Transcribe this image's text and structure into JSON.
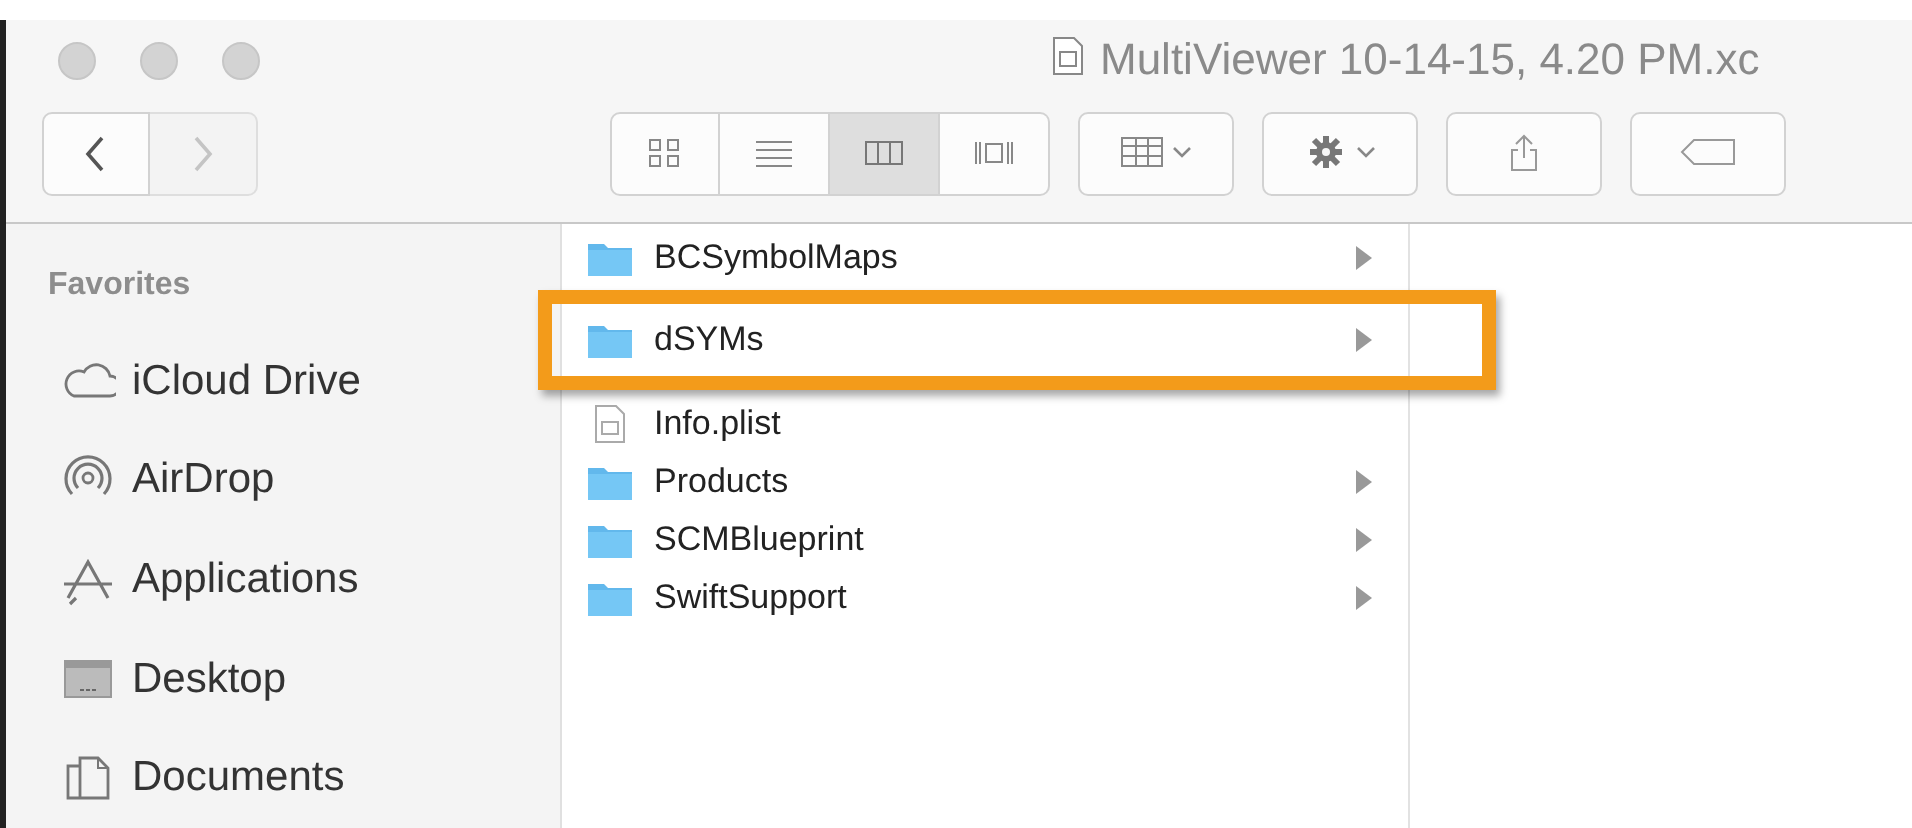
{
  "window": {
    "title": "MultiViewer 10-14-15, 4.20 PM.xc"
  },
  "toolbar": {
    "nav": [
      {
        "kind": "back",
        "disabled": false
      },
      {
        "kind": "forward",
        "disabled": true
      }
    ],
    "view_modes": [
      {
        "kind": "icons",
        "selected": false
      },
      {
        "kind": "list",
        "selected": false
      },
      {
        "kind": "columns",
        "selected": true
      },
      {
        "kind": "coverflow",
        "selected": false
      }
    ],
    "actions": [
      {
        "kind": "arrange"
      },
      {
        "kind": "action"
      },
      {
        "kind": "share"
      },
      {
        "kind": "tag"
      }
    ]
  },
  "sidebar": {
    "heading": "Favorites",
    "items": [
      {
        "label": "iCloud Drive",
        "kind": "cloud"
      },
      {
        "label": "AirDrop",
        "kind": "airdrop"
      },
      {
        "label": "Applications",
        "kind": "apps"
      },
      {
        "label": "Desktop",
        "kind": "desktop"
      },
      {
        "label": "Documents",
        "kind": "documents"
      }
    ]
  },
  "column": {
    "items": [
      {
        "name": "BCSymbolMaps",
        "kind": "folder",
        "has_children": true,
        "highlighted": false
      },
      {
        "name": "dSYMs",
        "kind": "folder",
        "has_children": true,
        "highlighted": true
      },
      {
        "name": "Info.plist",
        "kind": "file",
        "has_children": false,
        "highlighted": false
      },
      {
        "name": "Products",
        "kind": "folder",
        "has_children": true,
        "highlighted": false
      },
      {
        "name": "SCMBlueprint",
        "kind": "folder",
        "has_children": true,
        "highlighted": false
      },
      {
        "name": "SwiftSupport",
        "kind": "folder",
        "has_children": true,
        "highlighted": false
      }
    ]
  }
}
